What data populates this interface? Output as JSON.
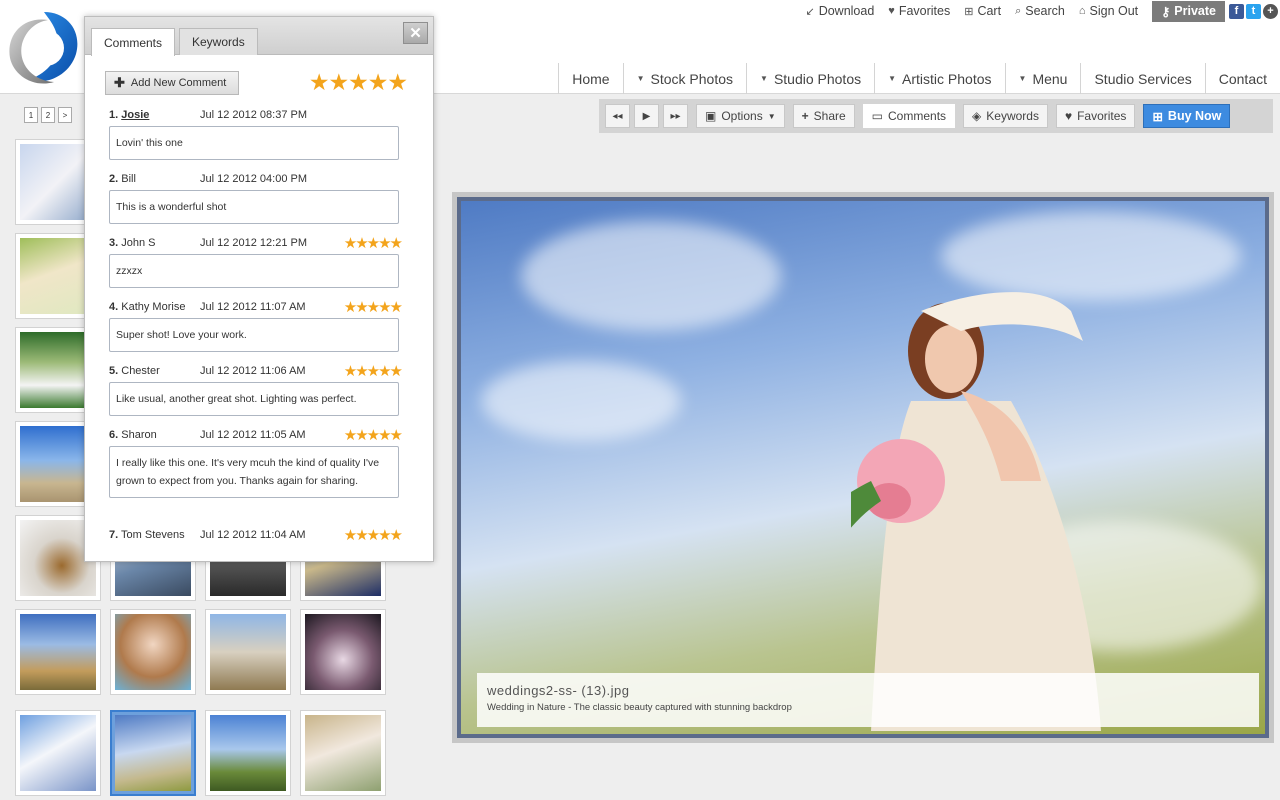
{
  "utility_links": [
    {
      "icon": "download-icon",
      "glyph": "↙",
      "label": "Download"
    },
    {
      "icon": "heart-icon",
      "glyph": "♥",
      "label": "Favorites"
    },
    {
      "icon": "cart-icon",
      "glyph": "⊞",
      "label": "Cart"
    },
    {
      "icon": "search-icon",
      "glyph": "⌕",
      "label": "Search"
    },
    {
      "icon": "home-icon",
      "glyph": "⌂",
      "label": "Sign Out"
    }
  ],
  "private_button": {
    "label": "Private",
    "icon": "key-icon"
  },
  "nav": [
    {
      "label": "Home",
      "dropdown": false
    },
    {
      "label": "Stock Photos",
      "dropdown": true
    },
    {
      "label": "Studio Photos",
      "dropdown": true
    },
    {
      "label": "Artistic Photos",
      "dropdown": true
    },
    {
      "label": "Menu",
      "dropdown": true
    },
    {
      "label": "Studio Services",
      "dropdown": false
    },
    {
      "label": "Contact",
      "dropdown": false
    }
  ],
  "pager": [
    "1",
    "2",
    ">"
  ],
  "toolbar": {
    "options_label": "Options",
    "share_label": "Share",
    "comments_label": "Comments",
    "keywords_label": "Keywords",
    "favorites_label": "Favorites",
    "buy_label": "Buy Now"
  },
  "photo": {
    "filename": "weddings2-ss- (13).jpg",
    "description": "Wedding in Nature - The classic beauty captured with stunning backdrop"
  },
  "popup": {
    "tabs": [
      "Comments",
      "Keywords"
    ],
    "close_label": "✕",
    "add_comment_label": "Add New Comment",
    "overall_rating": 5,
    "comments": [
      {
        "num": "1.",
        "name": "Josie",
        "date": "Jul 12 2012 08:37 PM",
        "stars": 0,
        "text": "Lovin' this one"
      },
      {
        "num": "2.",
        "name": "Bill",
        "date": "Jul 12 2012 04:00 PM",
        "stars": 0,
        "text": "This is a wonderful shot"
      },
      {
        "num": "3.",
        "name": "John S",
        "date": "Jul 12 2012 12:21 PM",
        "stars": 5,
        "text": "zzxzx"
      },
      {
        "num": "4.",
        "name": "Kathy Morise",
        "date": "Jul 12 2012 11:07 AM",
        "stars": 5,
        "text": "Super shot! Love your work."
      },
      {
        "num": "5.",
        "name": "Chester",
        "date": "Jul 12 2012 11:06 AM",
        "stars": 5,
        "text": "Like usual, another great shot. Lighting was perfect."
      },
      {
        "num": "6.",
        "name": "Sharon",
        "date": "Jul 12 2012 11:05 AM",
        "stars": 5,
        "text": "I really like this one. It's very mcuh the kind of quality I've grown to expect from you. Thanks again for sharing."
      },
      {
        "num": "7.",
        "name": "Tom Stevens",
        "date": "Jul 12 2012 11:04 AM",
        "stars": 5,
        "text": ""
      }
    ]
  },
  "colors": {
    "accent": "#3d8be0",
    "star": "#f3a41c",
    "active_thumb_border": "#3a7ecf"
  }
}
